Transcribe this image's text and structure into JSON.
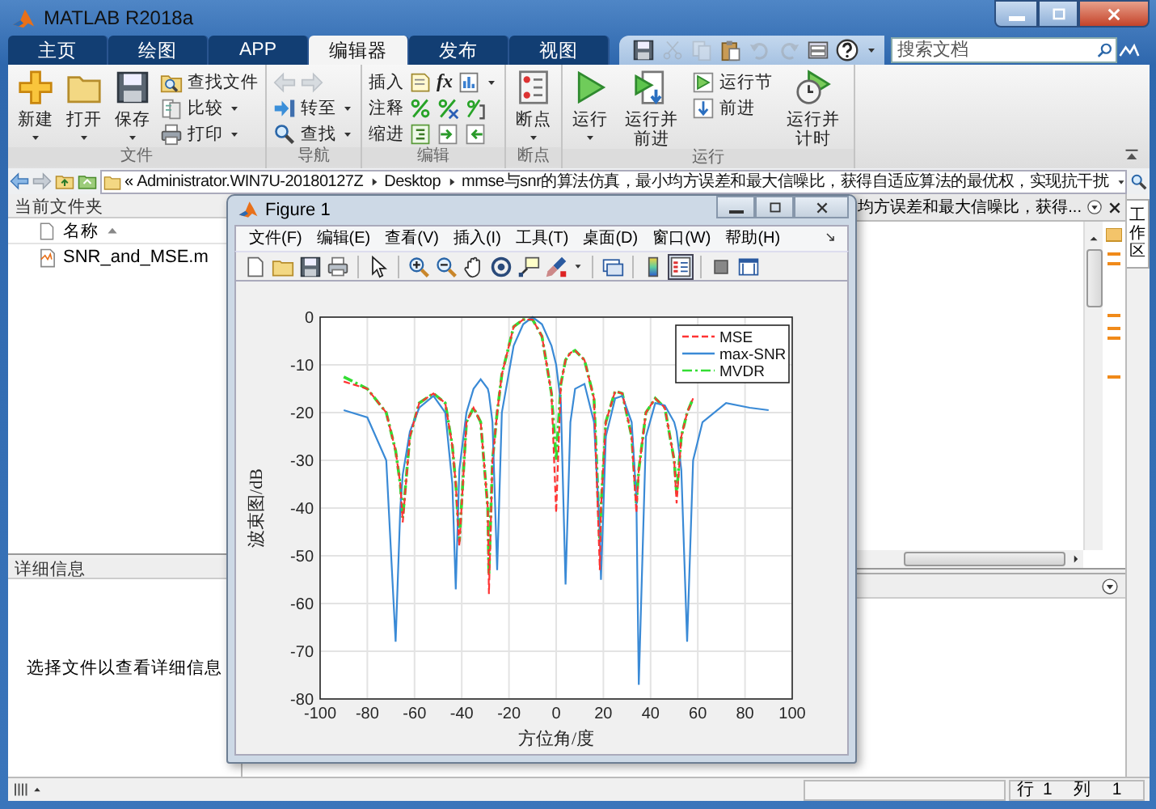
{
  "window": {
    "title": "MATLAB R2018a"
  },
  "tabs": [
    {
      "label": "主页",
      "selected": false
    },
    {
      "label": "绘图",
      "selected": false
    },
    {
      "label": "APP",
      "selected": false
    },
    {
      "label": "编辑器",
      "selected": true
    },
    {
      "label": "发布",
      "selected": false
    },
    {
      "label": "视图",
      "selected": false
    }
  ],
  "quick_access": {
    "tools": [
      {
        "disabled": false
      },
      {
        "disabled": true
      },
      {
        "disabled": true
      },
      {
        "disabled": false
      },
      {
        "disabled": true
      },
      {
        "disabled": true
      },
      {
        "disabled": false
      },
      {
        "disabled": false
      }
    ],
    "search": {
      "placeholder": "搜索文档"
    }
  },
  "ribbon": {
    "sections": [
      {
        "label": "文件",
        "items": [
          {
            "kind": "large",
            "label": "新建",
            "dropdown": true
          },
          {
            "kind": "large",
            "label": "打开",
            "dropdown": true
          },
          {
            "kind": "large",
            "label": "保存",
            "dropdown": true
          },
          {
            "kind": "stack",
            "rows": [
              {
                "kind": "button",
                "label": "查找文件",
                "dropdown": false
              },
              {
                "kind": "button",
                "label": "比较",
                "dropdown": true
              },
              {
                "kind": "button",
                "label": "打印",
                "dropdown": true
              }
            ]
          }
        ]
      },
      {
        "label": "导航",
        "items": [
          {
            "kind": "stack",
            "rows": [
              {
                "kind": "arrows",
                "disabled": true
              },
              {
                "kind": "button",
                "label": "转至",
                "dropdown": true
              },
              {
                "kind": "button",
                "label": "查找",
                "dropdown": true
              }
            ]
          }
        ]
      },
      {
        "label": "编辑",
        "items": [
          {
            "kind": "stack",
            "rows": [
              {
                "kind": "edit",
                "label": "插入",
                "glyph": "fx",
                "dropdown": true
              },
              {
                "kind": "edit",
                "label": "注释",
                "dropdown": false
              },
              {
                "kind": "edit",
                "label": "缩进",
                "dropdown": false
              }
            ]
          }
        ]
      },
      {
        "label": "断点",
        "items": [
          {
            "kind": "large",
            "label": "断点",
            "dropdown": true
          }
        ]
      },
      {
        "label": "运行",
        "items": [
          {
            "kind": "large",
            "label": "运行",
            "dropdown": true
          },
          {
            "kind": "large",
            "label": "运行并前进",
            "dropdown": false
          },
          {
            "kind": "stack",
            "rows": [
              {
                "kind": "button",
                "label": "运行节",
                "dropdown": false
              },
              {
                "kind": "button",
                "label": "前进",
                "dropdown": false
              }
            ]
          },
          {
            "kind": "large",
            "label": "运行并计时",
            "dropdown": false
          }
        ]
      }
    ]
  },
  "address_bar": {
    "overflow_mark": "«",
    "path": [
      "Administrator.WIN7U-20180127Z",
      "Desktop",
      "mmse与snr的算法仿真，最小均方误差和最大信噪比，获得自适应算法的最优权，实现抗干扰"
    ]
  },
  "current_folder": {
    "title": "当前文件夹",
    "column": {
      "label": "名称",
      "sort_ascending": true
    },
    "files": [
      {
        "name": "SNR_and_MSE.m"
      }
    ]
  },
  "details": {
    "title": "详细信息",
    "message": "选择文件以查看详细信息"
  },
  "editor": {
    "tab_title": "均方误差和最大信噪比，获得..."
  },
  "workspace_tab": {
    "label": "工作区"
  },
  "figure": {
    "title": "Figure 1",
    "menu": [
      "文件(F)",
      "编辑(E)",
      "查看(V)",
      "插入(I)",
      "工具(T)",
      "桌面(D)",
      "窗口(W)",
      "帮助(H)"
    ],
    "toolbar": [
      {
        "selected": false
      },
      {
        "selected": false
      },
      {
        "selected": false
      },
      {
        "selected": false
      },
      {
        "selected": false
      },
      {
        "selected": false
      },
      {
        "selected": false
      },
      {
        "selected": false
      },
      {
        "selected": false
      },
      {
        "selected": false
      },
      {
        "selected": false
      },
      {
        "selected": false
      },
      {
        "selected": false
      },
      {
        "selected": true
      },
      {
        "selected": false
      },
      {
        "selected": false
      }
    ],
    "axes": {
      "chart_data": {
        "type": "line",
        "grid": true,
        "legend": true,
        "xlabel": "方位角/度",
        "ylabel": "波束图/dB",
        "xlim": [
          -100,
          100
        ],
        "ylim": [
          -80,
          0
        ],
        "xticks": [
          -100,
          -80,
          -60,
          -40,
          -20,
          0,
          20,
          40,
          60,
          80,
          100
        ],
        "yticks": [
          -80,
          -70,
          -60,
          -50,
          -40,
          -30,
          -20,
          -10,
          0
        ],
        "x": [
          -90,
          -80,
          -72,
          -68,
          -66,
          -65,
          -62,
          -58,
          -52,
          -47,
          -44,
          -42.5,
          -41,
          -38,
          -35,
          -32,
          -29,
          -28.5,
          -27,
          -25,
          -23,
          -18,
          -14,
          -10,
          -6,
          -2,
          0,
          2,
          4,
          6,
          8,
          12,
          16,
          18.5,
          19,
          21,
          25,
          28,
          32,
          34,
          35,
          38,
          42,
          46,
          50,
          51,
          53,
          55.5,
          58,
          62,
          72,
          82,
          90
        ],
        "series": [
          {
            "name": "MSE",
            "color": "#ff3333",
            "line_style": "dashed",
            "values": [
              -13.5,
              -15,
              -20,
              -28,
              -35,
              -43,
              -25,
              -18,
              -16,
              -18,
              -27,
              -35,
              -48,
              -22,
              -19,
              -22,
              -40,
              -58,
              -30,
              -20,
              -12,
              -2,
              -0.5,
              -0.5,
              -4,
              -16,
              -41,
              -14,
              -9,
              -7.5,
              -7,
              -9,
              -17,
              -53,
              -40,
              -22,
              -15.5,
              -16,
              -25,
              -41,
              -32,
              -20,
              -17,
              -19,
              -30,
              -39,
              -25,
              -20,
              -17,
              null,
              null,
              null,
              null
            ]
          },
          {
            "name": "max-SNR",
            "color": "#3a8ad6",
            "line_style": "solid",
            "values": [
              -19.5,
              -21,
              -30,
              -68,
              -40,
              -33,
              -24,
              -19,
              -16.5,
              -20,
              -35,
              -57,
              -32,
              -20,
              -15,
              -13,
              -15,
              -16,
              -22,
              -53,
              -20,
              -6,
              -1.5,
              0,
              -1.5,
              -6,
              -10,
              -18,
              -56,
              -22,
              -15,
              -14,
              -22,
              -45,
              -55,
              -25,
              -17,
              -16.5,
              -22,
              -38,
              -77,
              -25,
              -18,
              -18.5,
              -22,
              -24,
              -32,
              -68,
              -30,
              -22,
              -18,
              -19,
              -19.5
            ]
          },
          {
            "name": "MVDR",
            "color": "#33dd33",
            "line_style": "dashdot",
            "values": [
              -12.5,
              -15,
              -20,
              -28,
              -35,
              -42,
              -25,
              -18,
              -16,
              -18,
              -27,
              -35,
              -47,
              -22,
              -19,
              -22,
              -40,
              -54,
              -30,
              -20,
              -12,
              -2,
              -0.5,
              -0.5,
              -4,
              -16,
              -30,
              -14,
              -9,
              -7.5,
              -7,
              -9,
              -17,
              -47,
              -40,
              -22,
              -15.5,
              -16,
              -25,
              -39,
              -32,
              -20,
              -17,
              -19,
              -30,
              -37,
              -25,
              -20,
              -17,
              null,
              null,
              null,
              null
            ]
          }
        ]
      }
    }
  },
  "status_bar": {
    "fields": [
      {
        "label": "行",
        "value": "1"
      },
      {
        "label": "列",
        "value": "1"
      }
    ]
  }
}
